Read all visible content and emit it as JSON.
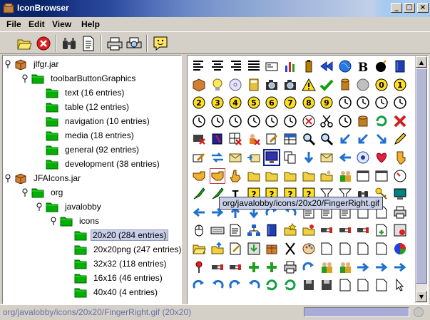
{
  "window": {
    "title": "IconBrowser"
  },
  "menu": [
    "File",
    "Edit",
    "View",
    "Help"
  ],
  "toolbar": [
    "open-folder-icon",
    "stop-icon",
    "binoculars-icon",
    "document-icon",
    "print-icon",
    "print-preview-icon",
    "smiley-icon"
  ],
  "tree": [
    {
      "label": "jlfgr.jar",
      "level": 0,
      "type": "jar",
      "handle": "expanded"
    },
    {
      "label": "toolbarButtonGraphics",
      "level": 1,
      "type": "folder",
      "handle": "expanded"
    },
    {
      "label": "text (16 entries)",
      "level": 2,
      "type": "folder",
      "handle": "none"
    },
    {
      "label": "table (12 entries)",
      "level": 2,
      "type": "folder",
      "handle": "none"
    },
    {
      "label": "navigation (10 entries)",
      "level": 2,
      "type": "folder",
      "handle": "none"
    },
    {
      "label": "media (18 entries)",
      "level": 2,
      "type": "folder",
      "handle": "none"
    },
    {
      "label": "general (92 entries)",
      "level": 2,
      "type": "folder",
      "handle": "none"
    },
    {
      "label": "development (38 entries)",
      "level": 2,
      "type": "folder",
      "handle": "none"
    },
    {
      "label": "JFAIcons.jar",
      "level": 0,
      "type": "jar",
      "handle": "expanded"
    },
    {
      "label": "org",
      "level": 1,
      "type": "folder",
      "handle": "expanded"
    },
    {
      "label": "javalobby",
      "level": 2,
      "type": "folder",
      "handle": "expanded"
    },
    {
      "label": "icons",
      "level": 3,
      "type": "folder",
      "handle": "expanded"
    },
    {
      "label": "20x20 (284 entries)",
      "level": 4,
      "type": "folder",
      "handle": "none",
      "selected": true
    },
    {
      "label": "20x20png (247 entries)",
      "level": 4,
      "type": "folder",
      "handle": "none"
    },
    {
      "label": "32x32 (118 entries)",
      "level": 4,
      "type": "folder",
      "handle": "none"
    },
    {
      "label": "16x16 (46 entries)",
      "level": 4,
      "type": "folder",
      "handle": "none"
    },
    {
      "label": "40x40 (4 entries)",
      "level": 4,
      "type": "folder",
      "handle": "none"
    }
  ],
  "grid": {
    "rows": [
      [
        "align-left",
        "align-center",
        "align-right",
        "justify",
        "card",
        "bar-chart",
        "battery",
        "rewind",
        "globe",
        "bold",
        "bomb",
        "book"
      ],
      [
        "box",
        "bulb",
        "cd",
        "calculator",
        "camera",
        "camera",
        "warning",
        "check",
        "cylinder",
        "circle",
        "zero",
        "one"
      ],
      [
        "two",
        "three",
        "four",
        "five",
        "six",
        "seven",
        "eight",
        "nine",
        "clock",
        "clock",
        "clock",
        "clock"
      ],
      [
        "clock",
        "clock",
        "clock",
        "clock",
        "clock",
        "clock",
        "cancel",
        "scissors",
        "clock",
        "database",
        "refresh",
        "delete"
      ],
      [
        "monitor-delete",
        "blue-book",
        "grid-delete",
        "person-delete",
        "edit",
        "table",
        "zoom",
        "zoom-in",
        "arrow-down-left",
        "arrow-down-left",
        "arrow-down-right",
        "pencil"
      ],
      [
        "pencil-edit",
        "swap",
        "envelope",
        "envelope-send",
        "display",
        "copy",
        "arrow-down",
        "envelope",
        "arrow-left",
        "eye",
        "heart",
        "hand-down"
      ],
      [
        "hand-right",
        "hand-right",
        "hand-up",
        "folder",
        "folder",
        "folder",
        "folder",
        "folder-person",
        "people",
        "window",
        "window",
        "gauge"
      ],
      [
        "pen",
        "pen",
        "text",
        "question",
        "question",
        "question",
        "help",
        "funnel",
        "funnel",
        "binoculars",
        "key",
        "monitor"
      ],
      [
        "arrow-left",
        "arrow-right",
        "arrow-up",
        "arrow-down",
        "redo",
        "undo",
        "text-page",
        "page",
        "page",
        "document",
        "document",
        "printer"
      ],
      [
        "mouse",
        "keyboard",
        "page",
        "network",
        "book",
        "folder-star",
        "folder-pin",
        "plug",
        "plug",
        "plug",
        "page-add",
        "record"
      ],
      [
        "folder-open",
        "folder-up",
        "document-write",
        "download",
        "package",
        "cut",
        "palette",
        "document",
        "document",
        "document",
        "document",
        "pie"
      ],
      [
        "pin",
        "plug-connect",
        "plug",
        "plus",
        "plus",
        "printer",
        "redo",
        "people",
        "people",
        "arrow-right",
        "arrow-right",
        "arrow-right"
      ],
      [
        "redo",
        "undo",
        "redo",
        "undo",
        "refresh",
        "refresh",
        "disk",
        "disk",
        "document",
        "document",
        "document",
        "cursor"
      ]
    ],
    "selected": [
      5,
      4
    ],
    "hover": [
      6,
      1
    ]
  },
  "tooltip": "org/javalobby/icons/20x20/FingerRight.gif",
  "status": {
    "text": "org/javalobby/icons/20x20/FingerRight.gif (20x20)",
    "progress_fraction": 1.0
  },
  "colors": {
    "title_gradient_start": "#0a246a",
    "title_gradient_end": "#a6caf0",
    "selection": "#c8d0e8",
    "folder": "#00b000",
    "status_text": "#6a70a8"
  }
}
